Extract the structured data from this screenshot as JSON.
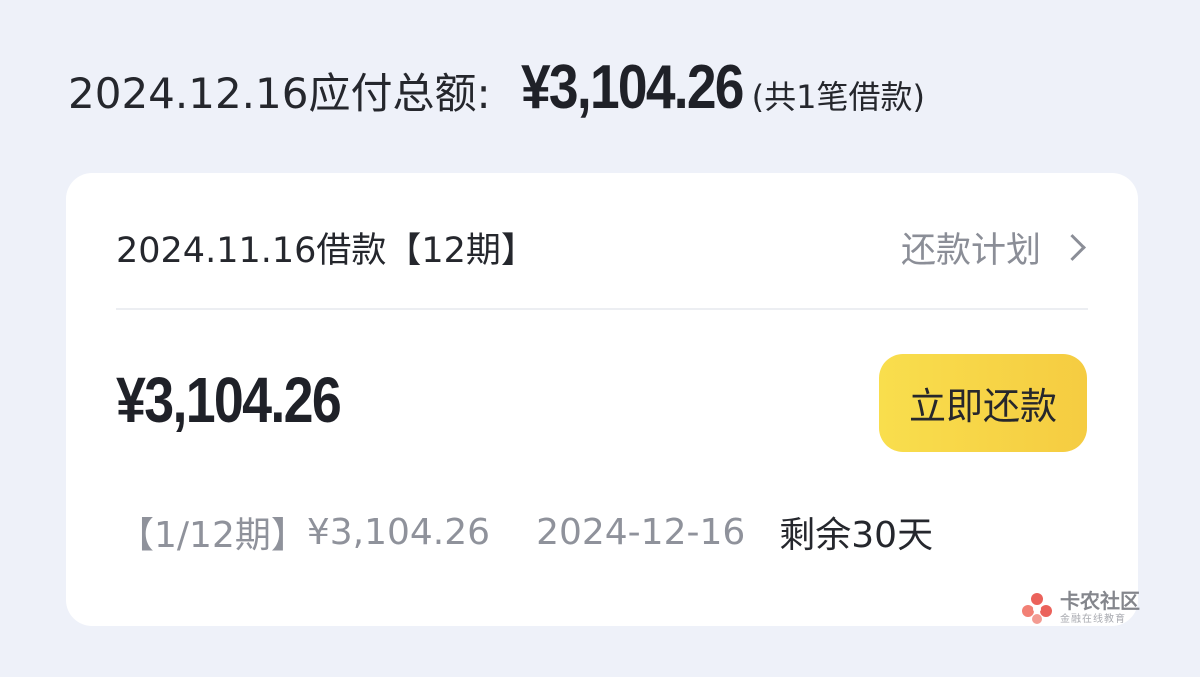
{
  "summary": {
    "label": "2024.12.16应付总额:",
    "amount": "¥3,104.26",
    "count": "(共1笔借款)"
  },
  "loan": {
    "title": "2024.11.16借款【12期】",
    "plan_link": "还款计划",
    "amount": "¥3,104.26",
    "repay_button": "立即还款",
    "installment": {
      "period": "【1/12期】",
      "amount": "¥3,104.26",
      "due_date": "2024-12-16",
      "remaining": "剩余30天"
    }
  },
  "watermark": {
    "name": "卡农社区",
    "tagline": "金融在线教育"
  },
  "colors": {
    "background": "#eef1f9",
    "card": "#ffffff",
    "button_start": "#f9de4d",
    "button_end": "#f5cc41",
    "muted_text": "#8f929b",
    "primary_text": "#24262c",
    "watermark_accent": "#e8473f"
  },
  "icons": {
    "plan_link_icon": "chevron-right-icon",
    "watermark_logo": "kanong-logo-icon"
  }
}
